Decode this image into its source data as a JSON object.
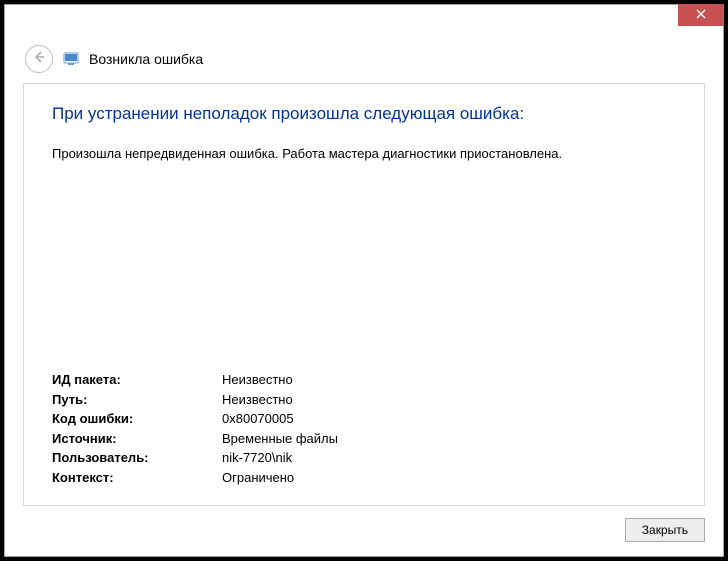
{
  "header": {
    "title": "Возникла ошибка"
  },
  "main": {
    "heading": "При устранении неполадок произошла следующая ошибка:",
    "message": "Произошла непредвиденная ошибка. Работа мастера диагностики приостановлена."
  },
  "details": [
    {
      "label": "ИД пакета:",
      "value": "Неизвестно"
    },
    {
      "label": "Путь:",
      "value": "Неизвестно"
    },
    {
      "label": "Код ошибки:",
      "value": "0x80070005"
    },
    {
      "label": "Источник:",
      "value": "Временные файлы"
    },
    {
      "label": "Пользователь:",
      "value": "nik-7720\\nik"
    },
    {
      "label": "Контекст:",
      "value": "Ограничено"
    }
  ],
  "footer": {
    "close_label": "Закрыть"
  }
}
